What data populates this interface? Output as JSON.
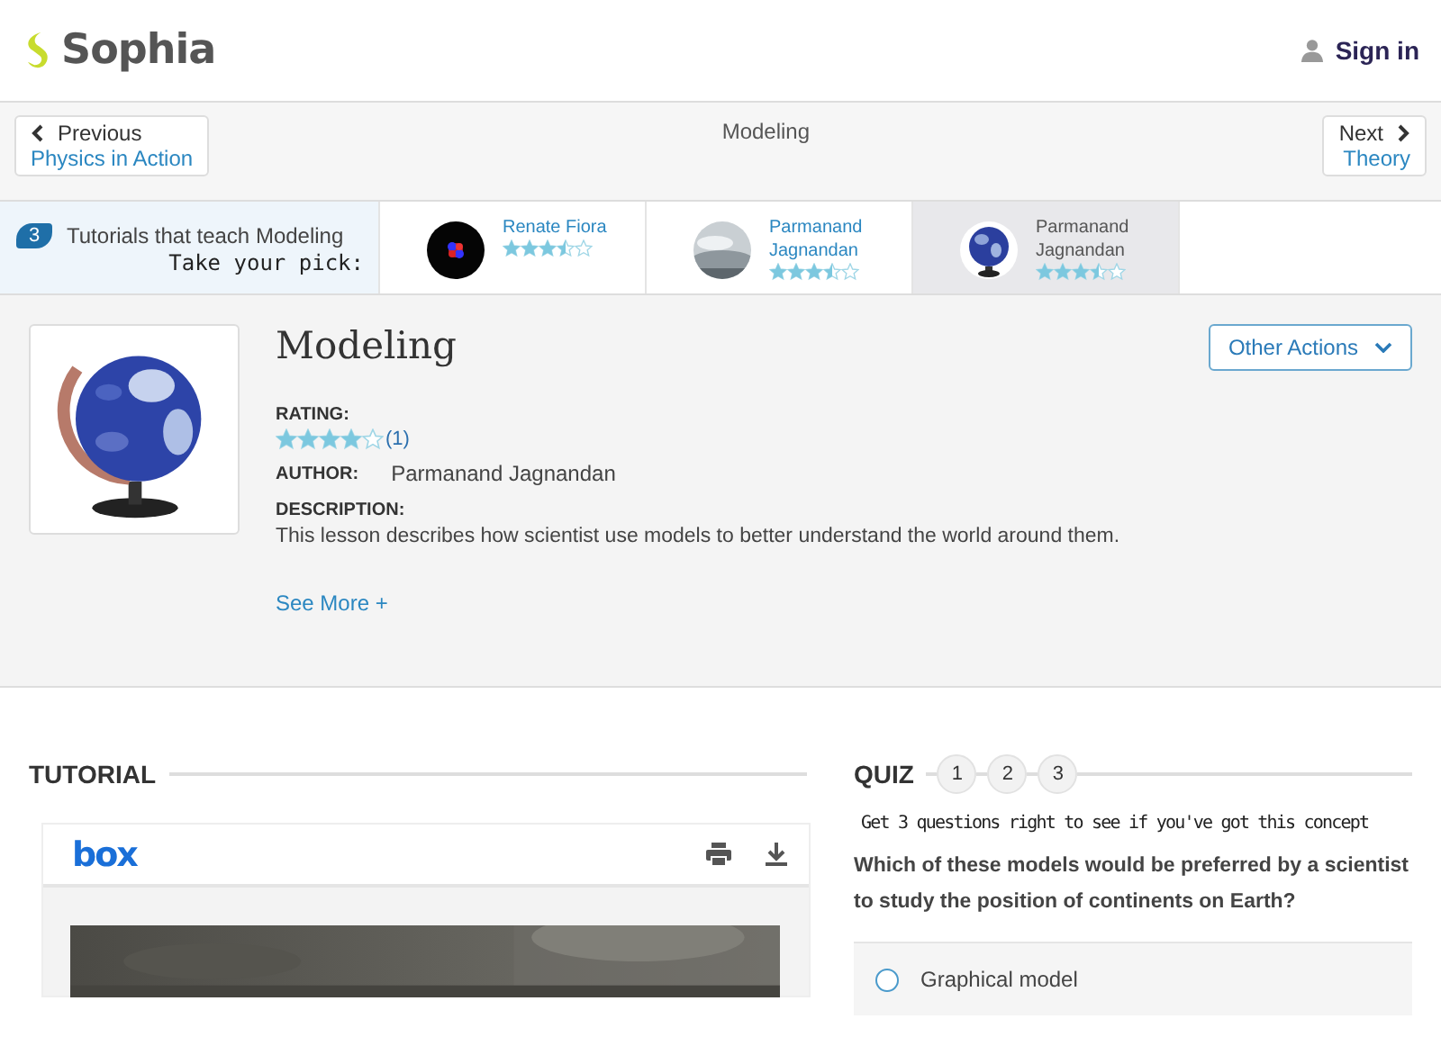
{
  "header": {
    "logo": "Sophia",
    "sign_in": "Sign in"
  },
  "nav": {
    "previous": {
      "label": "Previous",
      "title": "Physics in Action"
    },
    "current": "Modeling",
    "next": {
      "label": "Next",
      "title": "Theory"
    }
  },
  "tutorials_strip": {
    "count": "3",
    "label": "Tutorials that teach Modeling",
    "pick": "Take your pick:",
    "items": [
      {
        "author": "Renate Fiora",
        "stars": 3.5,
        "selected": false
      },
      {
        "author": "Parmanand Jagnandan",
        "stars": 3.5,
        "selected": false
      },
      {
        "author": "Parmanand Jagnandan",
        "stars": 3.5,
        "selected": true
      }
    ]
  },
  "lesson": {
    "title": "Modeling",
    "other_actions": "Other Actions",
    "rating_label": "RATING:",
    "stars": 4,
    "rating_count": "(1)",
    "author_label": "AUTHOR:",
    "author": "Parmanand Jagnandan",
    "description_label": "DESCRIPTION:",
    "description": "This lesson describes how scientist use models to better understand the world around them.",
    "see_more": "See More +"
  },
  "tutorial": {
    "heading": "TUTORIAL",
    "viewer_logo": "box"
  },
  "quiz": {
    "heading": "QUIZ",
    "steps": [
      {
        "label": "1",
        "selected": false
      },
      {
        "label": "2",
        "selected": false
      },
      {
        "label": "3",
        "selected": false
      }
    ],
    "hint": "Get 3 questions right to see if you've got this concept",
    "question": "Which of these models would be preferred by a scientist to study the position of continents on Earth?",
    "options": [
      {
        "label": "Graphical model",
        "checked": false
      }
    ]
  }
}
